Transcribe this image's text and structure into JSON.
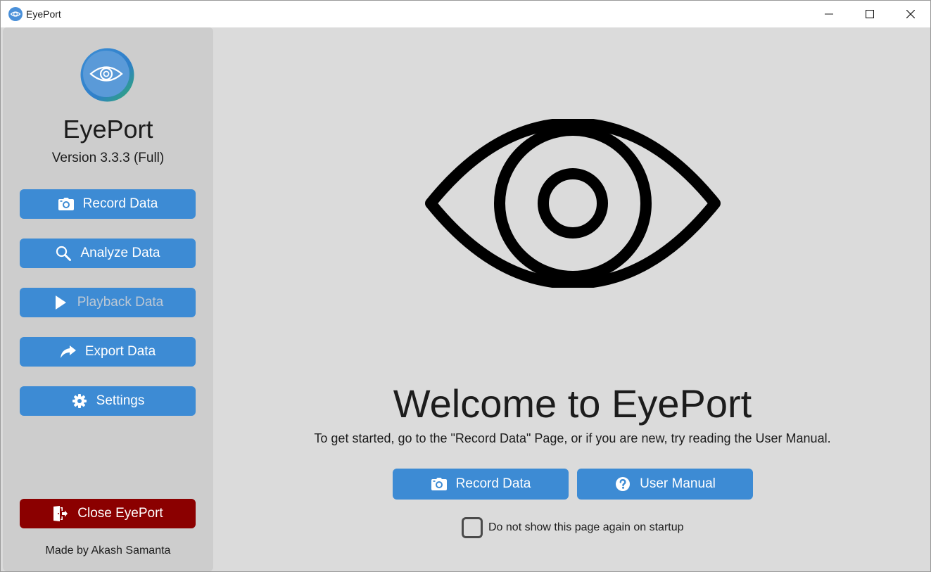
{
  "window": {
    "title": "EyePort",
    "app_icon": "eye-logo-icon",
    "controls": [
      "minimize-icon",
      "maximize-icon",
      "close-icon"
    ]
  },
  "sidebar": {
    "logo": "eye-logo-icon",
    "app_name": "EyePort",
    "version": "Version 3.3.3 (Full)",
    "buttons": [
      {
        "label": "Record Data",
        "icon": "camera-icon",
        "enabled": true
      },
      {
        "label": "Analyze Data",
        "icon": "search-icon",
        "enabled": true
      },
      {
        "label": "Playback Data",
        "icon": "play-icon",
        "enabled": false
      },
      {
        "label": "Export Data",
        "icon": "share-arrow-icon",
        "enabled": true
      },
      {
        "label": "Settings",
        "icon": "gear-icon",
        "enabled": true
      }
    ],
    "close_button": {
      "label": "Close EyePort",
      "icon": "exit-door-icon"
    },
    "credit": "Made by Akash Samanta"
  },
  "main": {
    "hero_icon": "eye-icon",
    "welcome_title": "Welcome to EyePort",
    "subtitle": "To get started, go to the \"Record Data\" Page, or if you are new, try reading the User Manual.",
    "buttons": [
      {
        "label": "Record Data",
        "icon": "camera-icon"
      },
      {
        "label": "User Manual",
        "icon": "help-circle-icon"
      }
    ],
    "startup_checkbox": {
      "label": "Do not show this page again on startup",
      "checked": false
    }
  },
  "colors": {
    "accent": "#3d8bd4",
    "danger": "#8b0000",
    "sidebar_bg": "#cdcdcd",
    "main_bg": "#dbdbdb",
    "disabled_text": "#bcc8d5"
  }
}
